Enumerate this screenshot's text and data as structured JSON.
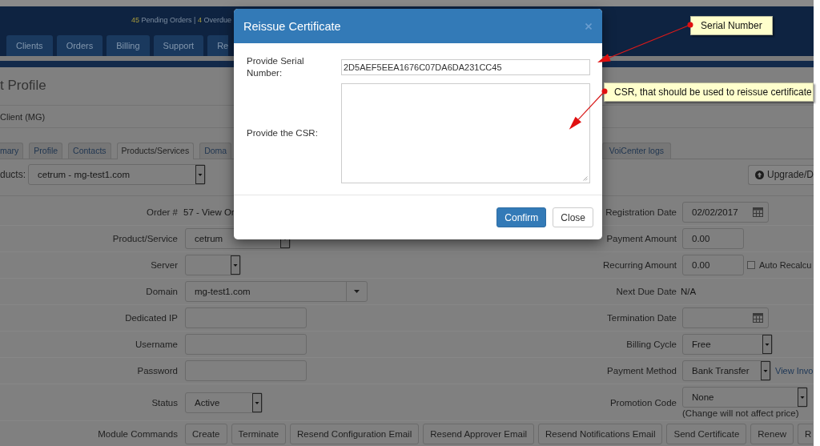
{
  "header": {
    "stats": [
      {
        "count": "45",
        "label": "Pending Orders"
      },
      {
        "count": "4",
        "label": "Overdue"
      }
    ],
    "separator": "|"
  },
  "nav": {
    "items": [
      {
        "label": "Clients"
      },
      {
        "label": "Orders"
      },
      {
        "label": "Billing"
      },
      {
        "label": "Support"
      },
      {
        "label": "Re"
      }
    ]
  },
  "page": {
    "title": "t Profile",
    "client": "Client (MG)",
    "tabs": [
      {
        "label": "mary",
        "selected": false
      },
      {
        "label": "Profile",
        "selected": false
      },
      {
        "label": "Contacts",
        "selected": false
      },
      {
        "label": "Products/Services",
        "selected": true
      },
      {
        "label": "Doma",
        "selected": false
      },
      {
        "label": "VoiCenter logs",
        "selected": false
      }
    ],
    "product_selector": {
      "label": "ducts:",
      "value": "cetrum - mg-test1.com"
    },
    "upgrade_button": "Upgrade/D"
  },
  "form": {
    "rows": [
      {
        "left": {
          "label": "Order #",
          "kind": "text",
          "value": "57 - View Or"
        },
        "right": {
          "label": "Registration Date",
          "kind": "date",
          "value": "02/02/2017"
        }
      },
      {
        "left": {
          "label": "Product/Service",
          "kind": "select",
          "value": "cetrum"
        },
        "right": {
          "label": "Payment Amount",
          "kind": "input",
          "value": "0.00"
        }
      },
      {
        "left": {
          "label": "Server",
          "kind": "select"
        },
        "right": {
          "label": "Recurring Amount",
          "kind": "input",
          "value": "0.00",
          "extra": {
            "kind": "checkbox",
            "label": "Auto Recalcu",
            "checked": false
          }
        }
      },
      {
        "left": {
          "label": "Domain",
          "kind": "combobox",
          "value": "mg-test1.com"
        },
        "right": {
          "label": "Next Due Date",
          "kind": "text",
          "value": "N/A"
        }
      },
      {
        "left": {
          "label": "Dedicated IP",
          "kind": "input"
        },
        "right": {
          "label": "Termination Date",
          "kind": "date"
        }
      },
      {
        "left": {
          "label": "Username",
          "kind": "input"
        },
        "right": {
          "label": "Billing Cycle",
          "kind": "select",
          "value": "Free"
        }
      },
      {
        "left": {
          "label": "Password",
          "kind": "input"
        },
        "right": {
          "label": "Payment Method",
          "kind": "select",
          "value": "Bank Transfer",
          "extra": {
            "kind": "link",
            "label": "View Invo"
          }
        }
      },
      {
        "left": {
          "label": "Status",
          "kind": "select",
          "value": "Active"
        },
        "right": {
          "label": "Promotion Code",
          "kind": "select",
          "value": "None",
          "extra": {
            "kind": "note",
            "label": "(Change will not affect price)"
          }
        }
      }
    ],
    "module_commands": {
      "label": "Module Commands",
      "buttons": [
        "Create",
        "Terminate",
        "Resend Configuration Email",
        "Resend Approver Email",
        "Resend Notifications Email",
        "Send Certificate",
        "Renew",
        "R"
      ]
    }
  },
  "dialog": {
    "title": "Reissue Certificate",
    "fields": [
      {
        "label": "Provide Serial Number:",
        "kind": "input",
        "value": "2D5AEF5EEA1676C07DA6DA231CC45"
      },
      {
        "label": "Provide the CSR:",
        "kind": "textarea"
      }
    ],
    "buttons": [
      {
        "label": "Confirm",
        "kind": "primary"
      },
      {
        "label": "Close",
        "kind": "default"
      }
    ]
  },
  "annotations": [
    {
      "text": "Serial Number"
    },
    {
      "text": "CSR, that should be used to reissue certificate"
    }
  ]
}
